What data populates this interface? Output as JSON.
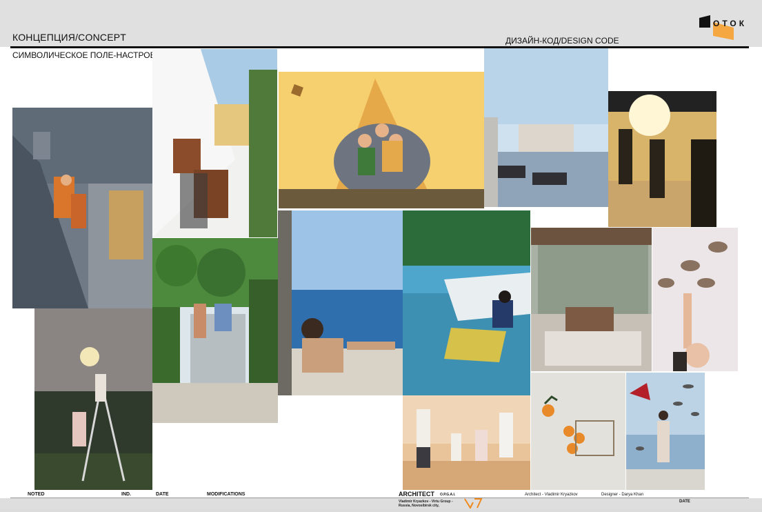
{
  "header": {
    "title_left": "КОНЦЕПЦИЯ/CONCEPT",
    "subtitle": "СИМВОЛИЧЕСКОЕ ПОЛЕ-НАСТРОЕНИЕ",
    "title_right": "ДИЗАЙН-КОД/DESIGN CODE",
    "logo_text": "ОТОК"
  },
  "footer": {
    "noted": "NOTED",
    "ind": "IND.",
    "date": "DATE",
    "modifications": "MODIFICATIONS",
    "architect": "ARCHITECT",
    "architect_code": "О.Р.G.A.I.",
    "architect_line1": "Vladimir Kryazkov - Virtu Group -",
    "architect_line2": "Russia, Novosibirsk city,",
    "architect_credit": "Architect - Vladimir Kryazkov",
    "designer_credit": "Designer - Darya Khan",
    "date_right": "DATE"
  },
  "colors": {
    "accent_orange": "#f5a742",
    "rule": "#111111"
  }
}
